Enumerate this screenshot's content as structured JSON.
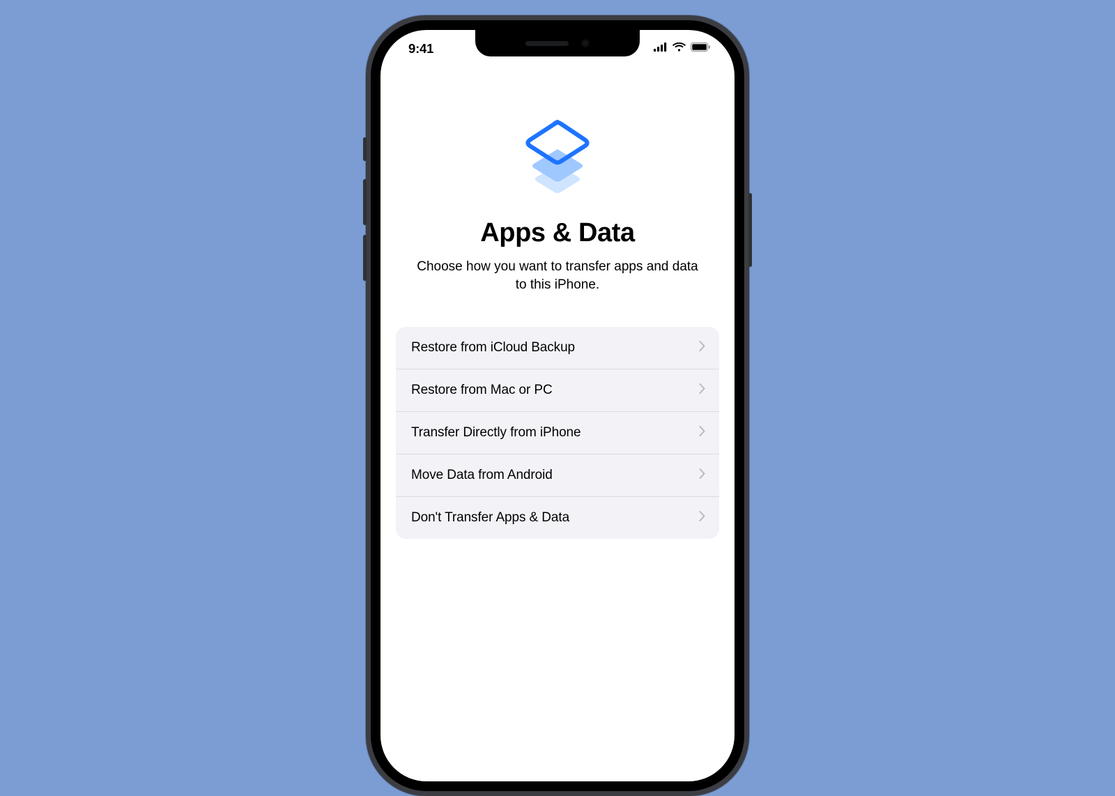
{
  "status": {
    "time": "9:41"
  },
  "screen": {
    "title": "Apps & Data",
    "subtitle": "Choose how you want to transfer apps and data to this iPhone.",
    "options": [
      {
        "label": "Restore from iCloud Backup"
      },
      {
        "label": "Restore from Mac or PC"
      },
      {
        "label": "Transfer Directly from iPhone"
      },
      {
        "label": "Move Data from Android"
      },
      {
        "label": "Don't Transfer Apps & Data"
      }
    ]
  }
}
